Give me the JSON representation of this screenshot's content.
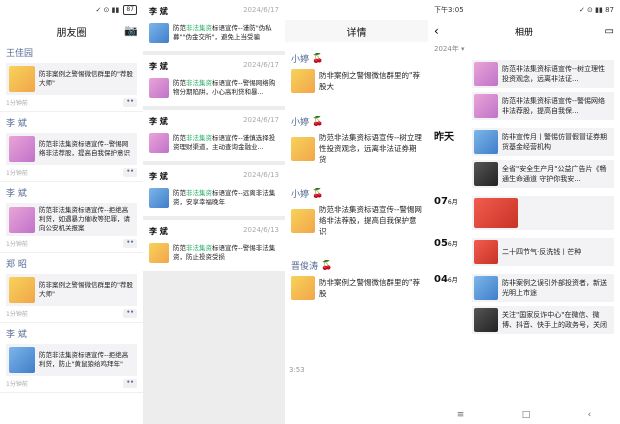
{
  "p1": {
    "status": {
      "signal": "✓ ⊙ ▮▮",
      "battery": "87"
    },
    "title": "朋友圈",
    "posts": [
      {
        "user": "王佳园",
        "text": "防非案例之警惕微信群里的\"荐股大师\"",
        "time": "1分钟前"
      },
      {
        "user": "李 斌",
        "text": "防范非法集资标语宣传--警惕网络非法荐股，提高自我保护意识",
        "time": "1分钟前"
      },
      {
        "user": "李 斌",
        "text": "防范非法集资标语宣传--拒绝高利贷，如遇暴力催收等犯罪，请向公安机关报案",
        "time": "1分钟前"
      },
      {
        "user": "郑 昭",
        "text": "防非案例之警惕微信群里的\"荐股大师\"",
        "time": "1分钟前"
      },
      {
        "user": "李 斌",
        "text": "防范非法集资标语宣传--拒绝高利贷，防止\"黄鼠狼给鸡拜年\"",
        "time": "1分钟前"
      }
    ]
  },
  "p2": {
    "items": [
      {
        "name": "李 斌",
        "date": "2024/6/17",
        "text_a": "防范",
        "hl": "非法集资",
        "text_b": "标语宣传--谨防\"伪私募\"\"伪金交所\"，避免上当受骗"
      },
      {
        "name": "李 斌",
        "date": "2024/6/17",
        "text_a": "防范",
        "hl": "非法集资",
        "text_b": "标语宣传--警惕网络购物分期陷阱，小心高利贷和暴..."
      },
      {
        "name": "李 斌",
        "date": "2024/6/17",
        "text_a": "防范",
        "hl": "非法集资",
        "text_b": "标语宣传--谨慎选择投资理财渠道，主动查询金融业..."
      },
      {
        "name": "李 斌",
        "date": "2024/6/13",
        "text_a": "防范",
        "hl": "非法集资",
        "text_b": "标语宣传--远离非法集资，安享幸福晚年"
      },
      {
        "name": "李 斌",
        "date": "2024/6/13",
        "text_a": "防范",
        "hl": "非法集资",
        "text_b": "标语宣传--警惕非法集资，防止投资受损"
      }
    ]
  },
  "p3": {
    "title": "详情",
    "rows": [
      {
        "name": "小婷",
        "text": "防非案例之警惕微信群里的\"荐股大"
      },
      {
        "name": "小婷",
        "text": "防范非法集资标语宣传--树立理性投资观念，远离非法证券期货"
      },
      {
        "name": "小婷",
        "text": "防范非法集资标语宣传--警惕网络非法荐股，提高自我保护意识"
      },
      {
        "name": "晋俊涛",
        "text": "防非案例之警惕微信群里的\"荐股"
      }
    ],
    "footer_time": "3:53"
  },
  "p4": {
    "status_time": "下午3:05",
    "status_right": "✓ ⊙ ▮▮ 87",
    "title": "相册",
    "year": "2024年",
    "groups": [
      {
        "date": "",
        "month": "",
        "items": [
          {
            "text": "防范非法集资标语宣传--树立理性投资观念，远离非法证..."
          },
          {
            "text": "防范非法集资标语宣传--警惕网络非法荐股，提高自我保..."
          }
        ]
      },
      {
        "date": "昨天",
        "month": "",
        "items": [
          {
            "text": "防非宣传月丨警惕仿冒假冒证券期货基金经营机构"
          },
          {
            "text": "全省\"安全生产月\"公益广告片《畅通生命通道 守护你我安..."
          }
        ]
      },
      {
        "date": "07",
        "month": "6月",
        "items": [
          {
            "text": ""
          }
        ]
      },
      {
        "date": "05",
        "month": "6月",
        "items": [
          {
            "text": "二十四节气·反洗钱丨芒种"
          }
        ]
      },
      {
        "date": "04",
        "month": "6月",
        "items": [
          {
            "text": "防非案例之误引外部投资者，新送光明上市途"
          },
          {
            "text": "关注\"国家反诈中心\"在微信、微博、抖音、快手上的政务号，关闭手机境外..."
          }
        ]
      }
    ],
    "nav": [
      "≡",
      "□",
      "‹"
    ]
  }
}
